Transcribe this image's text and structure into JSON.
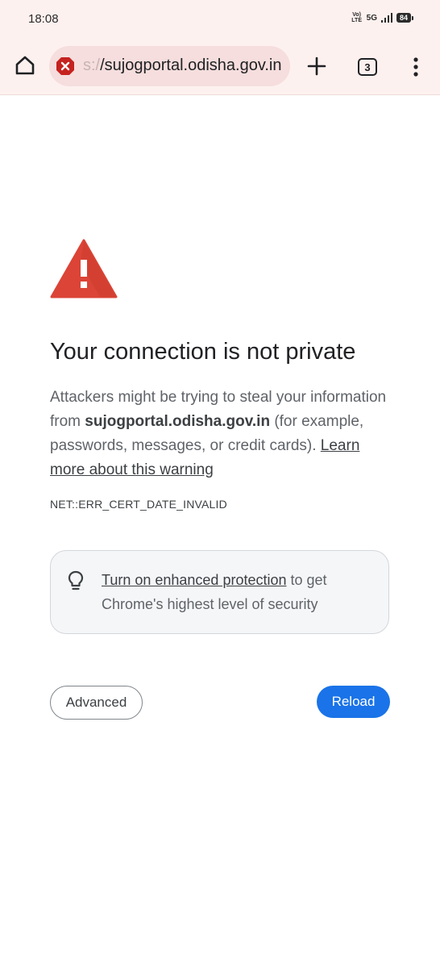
{
  "status_bar": {
    "time": "18:08",
    "volte_top": "Vo)",
    "volte_bottom": "LTE",
    "network": "5G",
    "battery": "84"
  },
  "toolbar": {
    "url_prefix": "s:/",
    "url_host": "/sujogportal.odisha.gov.in",
    "tab_count": "3",
    "icons": [
      "home-icon",
      "not-secure-icon",
      "new-tab-icon",
      "tab-switcher-icon",
      "more-vert-icon"
    ]
  },
  "interstitial": {
    "heading": "Your connection is not private",
    "body_before_host": "Attackers might be trying to steal your information from ",
    "host": "sujogportal.odisha.gov.in",
    "body_after_host": " (for example, passwords, messages, or credit cards). ",
    "learn_more": "Learn more about this warning",
    "error_code": "NET::ERR_CERT_DATE_INVALID",
    "protection_link": "Turn on enhanced protection",
    "protection_rest": " to get Chrome's highest level of security",
    "advanced_label": "Advanced",
    "reload_label": "Reload"
  },
  "colors": {
    "chrome_bg": "#fdf1ef",
    "url_pill": "#f5dedd",
    "warning_red": "#db4437",
    "primary_blue": "#1a73e8"
  }
}
